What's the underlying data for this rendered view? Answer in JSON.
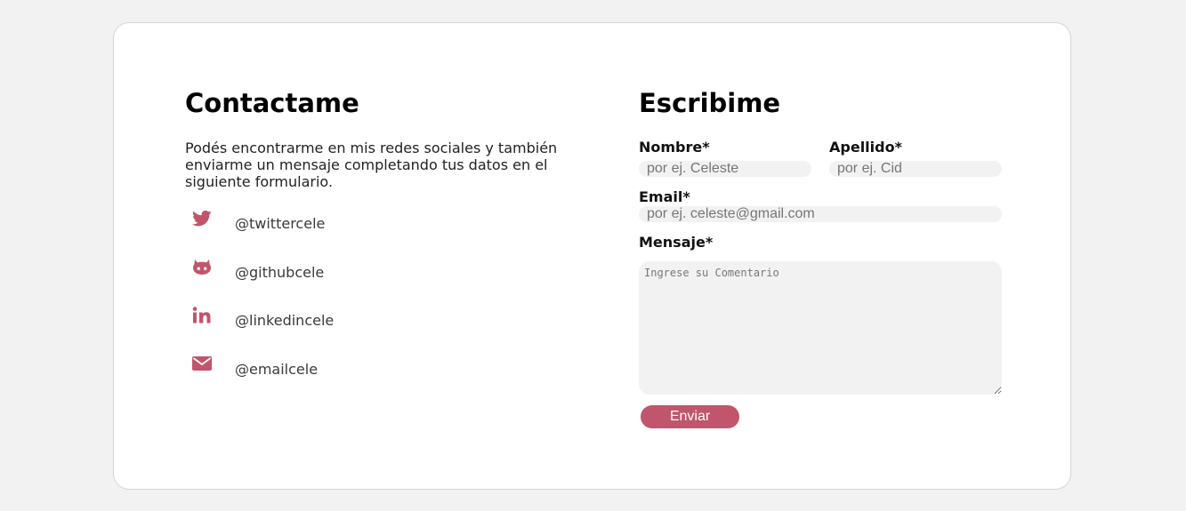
{
  "theme": {
    "accent": "#c0556b",
    "card_bg": "#ffffff",
    "page_bg": "#f2f2f2",
    "field_bg": "#f2f2f2"
  },
  "contact": {
    "title": "Contactame",
    "intro": "Podés encontrarme en mis redes sociales y también enviarme un mensaje completando tus datos en el siguiente formulario.",
    "socials": [
      {
        "icon": "twitter-icon",
        "handle": "@twittercele"
      },
      {
        "icon": "github-icon",
        "handle": "@githubcele"
      },
      {
        "icon": "linkedin-icon",
        "handle": "@linkedincele"
      },
      {
        "icon": "email-icon",
        "handle": "@emailcele"
      }
    ]
  },
  "form": {
    "title": "Escribime",
    "nombre": {
      "label": "Nombre*",
      "placeholder": "por ej. Celeste"
    },
    "apellido": {
      "label": "Apellido*",
      "placeholder": "por ej. Cid"
    },
    "email": {
      "label": "Email*",
      "placeholder": "por ej. celeste@gmail.com"
    },
    "mensaje": {
      "label": "Mensaje*",
      "placeholder": "Ingrese su Comentario"
    },
    "submit_label": "Enviar"
  }
}
